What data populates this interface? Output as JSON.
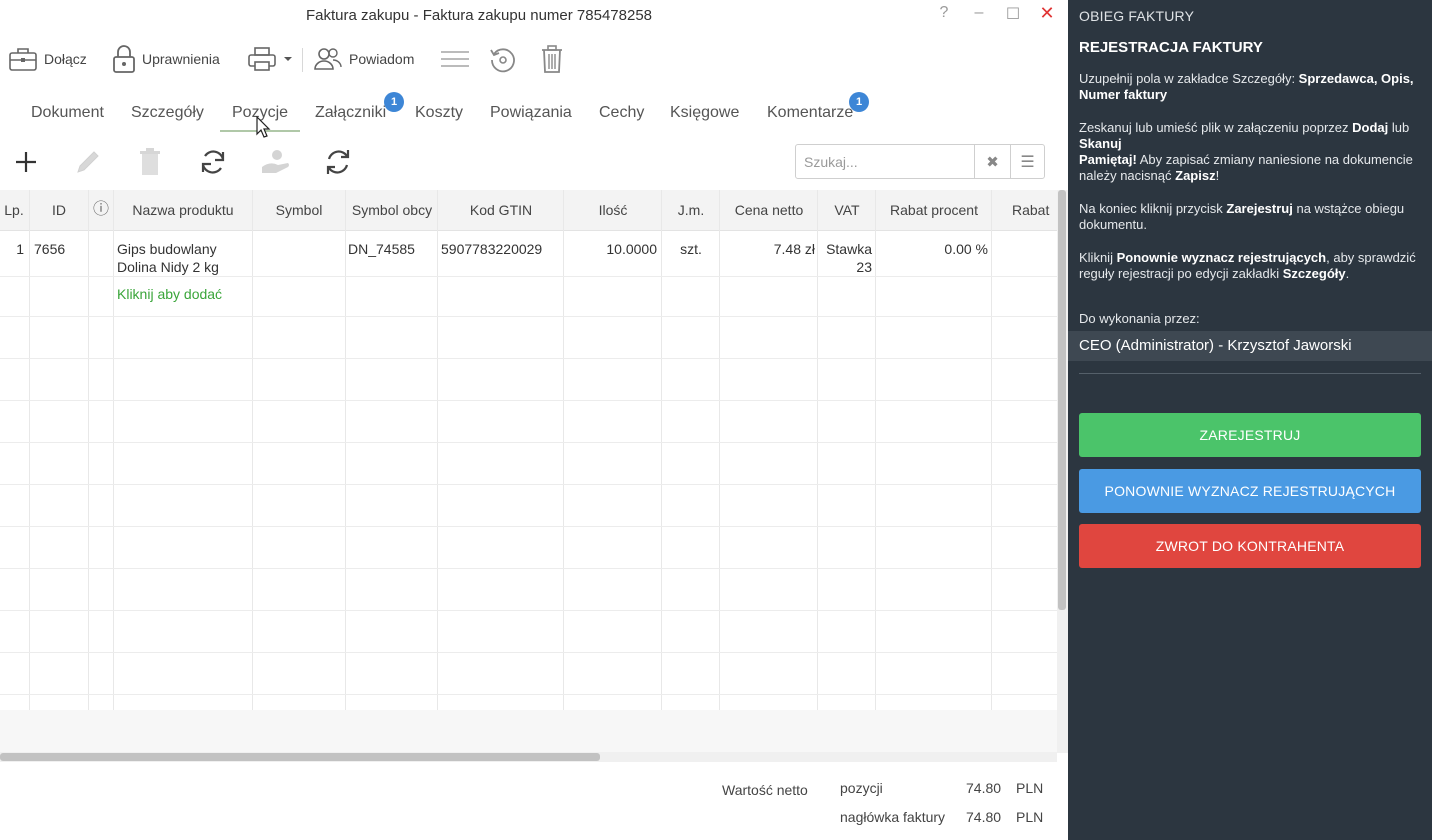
{
  "window": {
    "title": "Faktura zakupu - Faktura zakupu numer 785478258",
    "help": "?",
    "minimize": "–",
    "maximize": "☐",
    "close": "✕"
  },
  "toolbar": {
    "attach_label": "Dołącz",
    "permissions_label": "Uprawnienia",
    "notify_label": "Powiadom"
  },
  "tabs": [
    {
      "label": "Dokument"
    },
    {
      "label": "Szczegóły"
    },
    {
      "label": "Pozycje",
      "active": true
    },
    {
      "label": "Załączniki",
      "badge": "1"
    },
    {
      "label": "Koszty"
    },
    {
      "label": "Powiązania"
    },
    {
      "label": "Cechy"
    },
    {
      "label": "Księgowe"
    },
    {
      "label": "Komentarze",
      "badge": "1"
    }
  ],
  "search": {
    "placeholder": "Szukaj...",
    "clear": "✖",
    "menu": "☰"
  },
  "grid": {
    "columns": [
      "Lp.",
      "ID",
      "ⓘ",
      "Nazwa produktu",
      "Symbol",
      "Symbol obcy",
      "Kod GTIN",
      "Ilość",
      "J.m.",
      "Cena netto",
      "VAT",
      "Rabat procent",
      "Rabat"
    ],
    "rows": [
      {
        "lp": "1",
        "id": "7656",
        "name_line1": "Gips budowlany",
        "name_line2": "Dolina Nidy 2 kg",
        "symbol": "",
        "symbol_obcy": "DN_74585",
        "gtin": "5907783220029",
        "ilosc": "10.0000",
        "jm": "szt.",
        "cena_netto": "7.48 zł",
        "vat_line1": "Stawka",
        "vat_line2": "23",
        "rabat_procent": "0.00 %"
      }
    ],
    "add_row_label": "Kliknij aby dodać"
  },
  "totals": {
    "label": "Wartość netto",
    "positions_label": "pozycji",
    "positions_value": "74.80",
    "positions_currency": "PLN",
    "header_label": "nagłówka faktury",
    "header_value": "74.80",
    "header_currency": "PLN"
  },
  "panel": {
    "header": "OBIEG FAKTURY",
    "title": "REJESTRACJA FAKTURY",
    "p1_text": "Uzupełnij pola w zakładce Szczegóły: ",
    "p1_bold": "Sprzedawca, Opis, Numer faktury",
    "p2_a": "Zeskanuj lub umieść plik w załączeniu poprzez ",
    "p2_b1": "Dodaj",
    "p2_c": " lub ",
    "p2_b2": "Skanuj",
    "p3_b1": "Pamiętaj!",
    "p3_a": " Aby zapisać zmiany naniesione na dokumencie należy nacisnąć ",
    "p3_b2": "Zapisz",
    "p3_c": "!",
    "p4_a": "Na koniec kliknij przycisk ",
    "p4_b": "Zarejestruj",
    "p4_c": " na wstążce obiegu dokumentu.",
    "p5_a": "Kliknij ",
    "p5_b": "Ponownie wyznacz rejestrujących",
    "p5_c": ", aby sprawdzić reguły rejestracji po edycji zakładki ",
    "p5_d": "Szczegóły",
    "p5_e": ".",
    "todo_label": "Do wykonania przez:",
    "assignee": "CEO (Administrator) - Krzysztof Jaworski",
    "btn_register": "ZAREJESTRUJ",
    "btn_recompute": "PONOWNIE WYZNACZ REJESTRUJĄCYCH",
    "btn_return": "ZWROT DO KONTRAHENTA"
  },
  "colors": {
    "panel_bg": "#2c3640",
    "register": "#4bc46a",
    "recompute": "#4a9ae3",
    "return": "#e0463f",
    "badge": "#3d86d6",
    "add_row": "#3aa53a"
  }
}
